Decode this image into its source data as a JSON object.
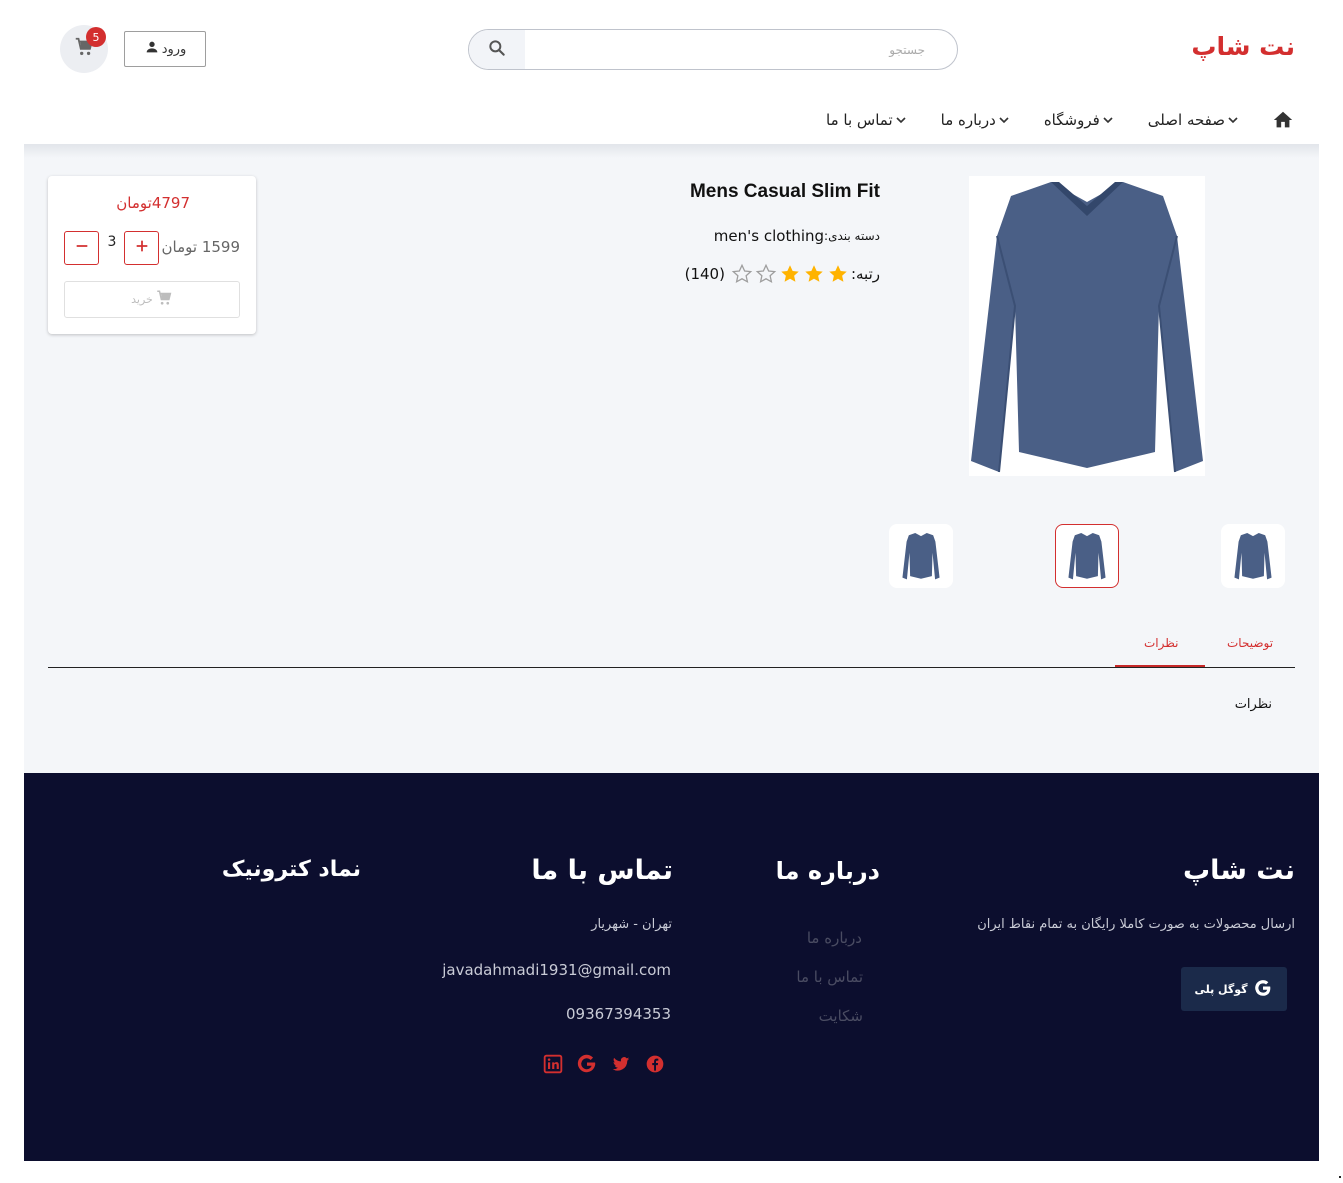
{
  "header": {
    "brand": "نت شاپ",
    "search": {
      "placeholder": "جستجو",
      "value": ""
    },
    "login_label": "ورود",
    "cart_count": "5",
    "nav": [
      {
        "label": "صفحه اصلی"
      },
      {
        "label": "فروشگاه"
      },
      {
        "label": "درباره ما"
      },
      {
        "label": "تماس با ما"
      }
    ]
  },
  "product": {
    "title": "Mens Casual Slim Fit",
    "category_label": "دسته بندی:",
    "category": "men's clothing",
    "rating_label": "رتبه:",
    "rating": 3,
    "rating_max": 5,
    "rating_count": "(140)"
  },
  "purchase": {
    "total": "4797تومان",
    "unit_price": "1599 تومان",
    "quantity": "3",
    "buy_label": "خرید"
  },
  "tabs": {
    "description": "توضیحات",
    "comments": "نظرات",
    "panel_text": "نظرات"
  },
  "footer": {
    "brand": "نت شاپ",
    "tagline": "ارسال محصولات به صورت کاملا رایگان به تمام نقاط ایران",
    "gplay_label": "گوگل پلی",
    "about": {
      "title": "درباره ما",
      "links": [
        "درباره ما",
        "تماس با ما",
        "شکایت"
      ]
    },
    "contact": {
      "title": "تماس با ما",
      "address": "تهران - شهریار",
      "email": "javadahmadi1931@gmail.com",
      "phone": "09367394353"
    },
    "enamad_title": "نماد کترونیک"
  },
  "colors": {
    "accent": "#d32f2f",
    "footer_bg": "#0c0e2e",
    "star": "#ffb300"
  }
}
